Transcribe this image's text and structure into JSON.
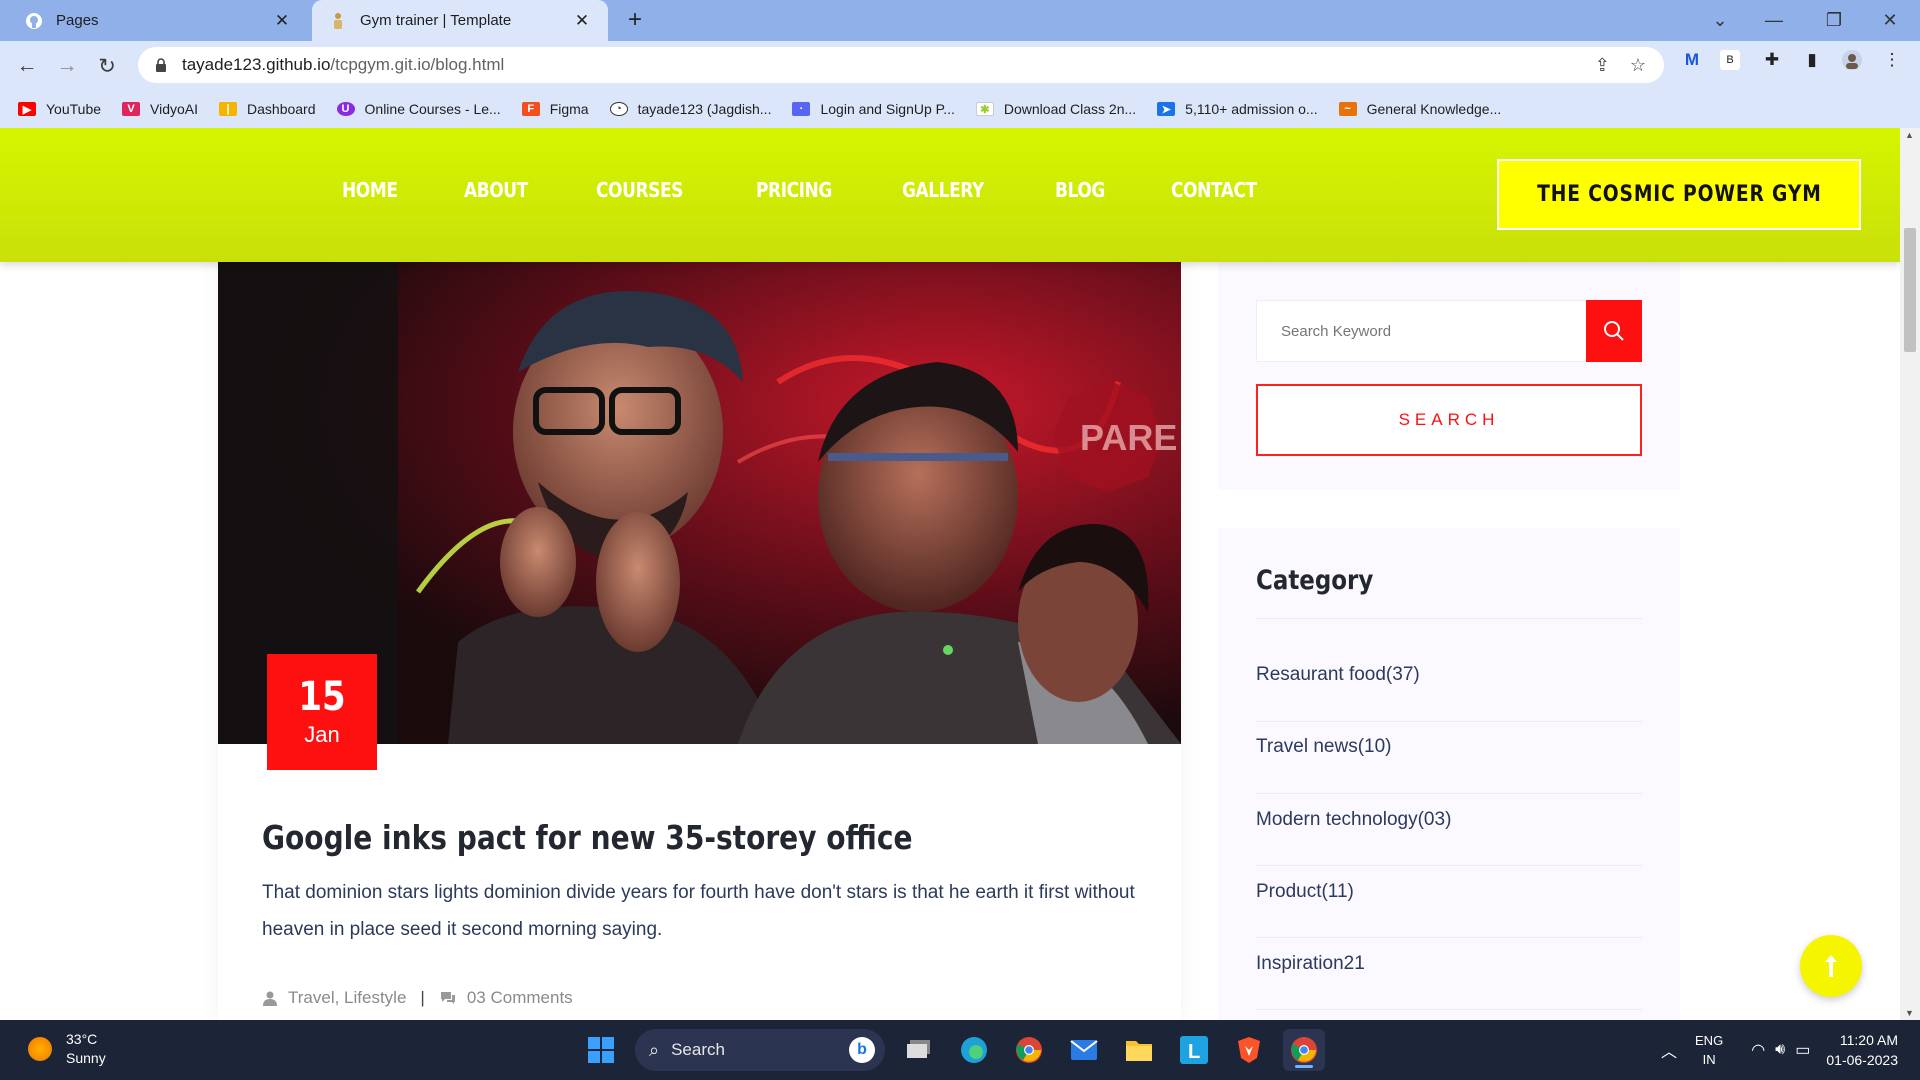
{
  "browser": {
    "tabs": [
      {
        "title": "Pages",
        "icon": "github-icon"
      },
      {
        "title": "Gym trainer | Template",
        "icon": "page-favicon"
      }
    ],
    "url_host": "tayade123.github.io",
    "url_path": "/tcpgym.git.io/blog.html",
    "bookmarks": [
      {
        "label": "YouTube",
        "color": "#ff0000"
      },
      {
        "label": "VidyoAI",
        "color": "#e0245e"
      },
      {
        "label": "Dashboard",
        "color": "#f4b400"
      },
      {
        "label": "Online Courses - Le...",
        "color": "#8a2be2"
      },
      {
        "label": "Figma",
        "color": "#f24e1e"
      },
      {
        "label": "tayade123 (Jagdish...",
        "color": "#333333"
      },
      {
        "label": "Login and SignUp P...",
        "color": "#5865f2"
      },
      {
        "label": "Download Class 2n...",
        "color": "#9acd32"
      },
      {
        "label": "5,110+ admission o...",
        "color": "#1a73e8"
      },
      {
        "label": "General Knowledge...",
        "color": "#e8710a"
      }
    ]
  },
  "site": {
    "nav": [
      "HOME",
      "ABOUT",
      "COURSES",
      "PRICING",
      "GALLERY",
      "BLOG",
      "CONTACT"
    ],
    "brand_button": "THE COSMIC POWER GYM",
    "accent": "#d5f500",
    "red": "#ff1010"
  },
  "post": {
    "day": "15",
    "month": "Jan",
    "title": "Google inks pact for new 35-storey office",
    "body": "That dominion stars lights dominion divide years for fourth have don't stars is that he earth it first without heaven in place seed it second morning saying.",
    "tags": "Travel, Lifestyle",
    "comments": "03 Comments",
    "image_sign": "PARE"
  },
  "sidebar": {
    "search_placeholder": "Search Keyword",
    "search_button": "SEARCH",
    "category_title": "Category",
    "categories": [
      "Resaurant food(37)",
      "Travel news(10)",
      "Modern technology(03)",
      "Product(11)",
      "Inspiration21"
    ]
  },
  "taskbar": {
    "temp": "33°C",
    "weather": "Sunny",
    "search_label": "Search",
    "lang_top": "ENG",
    "lang_bottom": "IN",
    "time": "11:20 AM",
    "date": "01-06-2023"
  }
}
